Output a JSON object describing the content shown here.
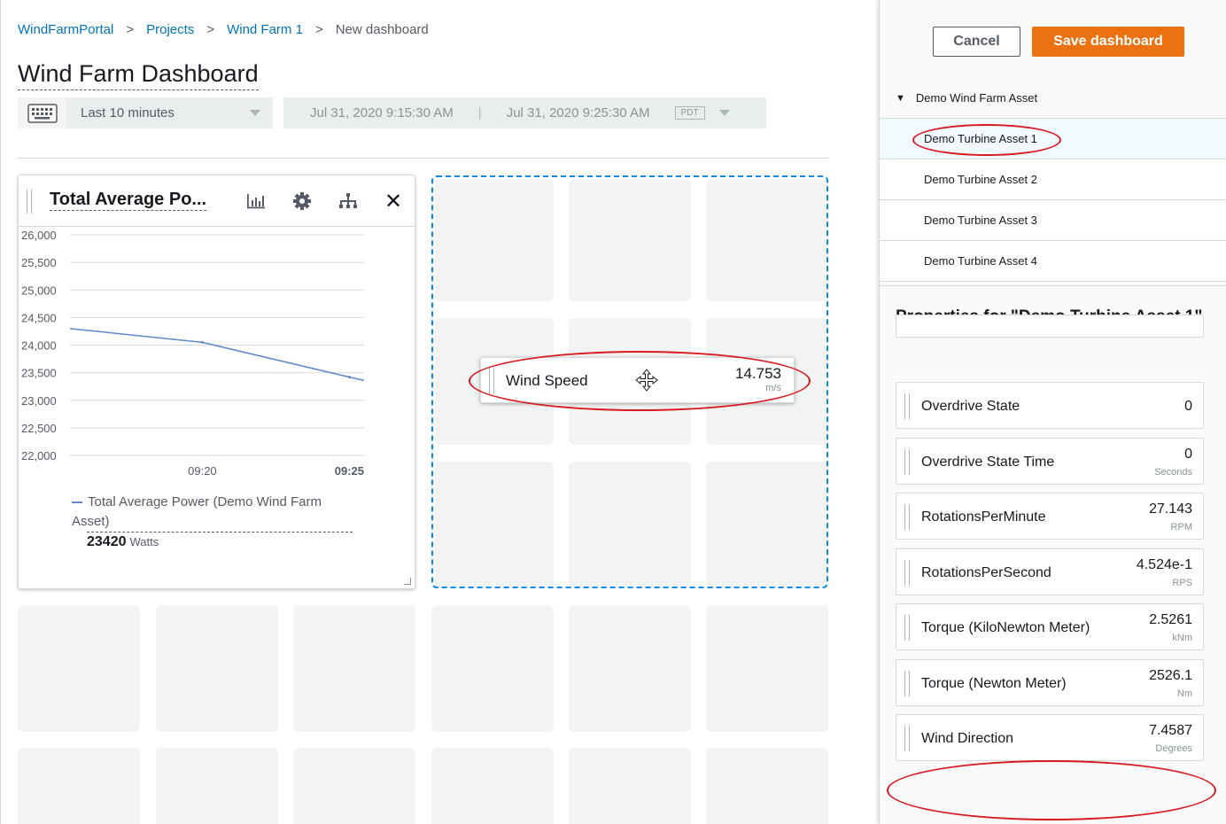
{
  "breadcrumb": {
    "items": [
      "WindFarmPortal",
      "Projects",
      "Wind Farm 1"
    ],
    "current": "New dashboard",
    "separator": ">"
  },
  "page_title": "Wind Farm Dashboard",
  "time_controls": {
    "range": "Last 10 minutes",
    "start": "Jul 31, 2020 9:15:30 AM",
    "end": "Jul 31, 2020 9:25:30 AM",
    "range_separator": "|",
    "timezone": "PDT"
  },
  "line_widget": {
    "title": "Total Average Po...",
    "icons": [
      "bar-chart-icon",
      "gear-icon",
      "hierarchy-icon",
      "close-icon"
    ],
    "close_glyph": "✕",
    "legend_name": "Total Average Power (Demo Wind Farm Asset)",
    "legend_value": "23420",
    "legend_unit": "Watts"
  },
  "chart_data": {
    "type": "line",
    "title": "Total Average Po...",
    "xlabel": "",
    "ylabel": "",
    "ylim": [
      22000,
      26000
    ],
    "y_ticks": [
      "26,000",
      "25,500",
      "25,000",
      "24,500",
      "24,000",
      "23,500",
      "23,000",
      "22,500",
      "22,000"
    ],
    "x_ticks": [
      "09:20",
      "09:25"
    ],
    "series": [
      {
        "name": "Total Average Power (Demo Wind Farm Asset)",
        "x": [
          "09:15:30",
          "09:20",
          "09:25",
          "09:25:30"
        ],
        "values": [
          24300,
          24050,
          23420,
          23360
        ]
      }
    ],
    "color": "#5f87c9",
    "grid": true
  },
  "dragged_widget": {
    "name": "Wind Speed",
    "value": "14.753",
    "unit": "m/s"
  },
  "side_panel": {
    "cancel_label": "Cancel",
    "save_label": "Save dashboard",
    "tree": {
      "root": "Demo Wind Farm Asset",
      "root_caret": "▼",
      "children": [
        "Demo Turbine Asset 1",
        "Demo Turbine Asset 2",
        "Demo Turbine Asset 3",
        "Demo Turbine Asset 4"
      ]
    },
    "properties_title": "Properties for \"Demo Turbine Asset 1\"",
    "properties": [
      {
        "name": "Overdrive State",
        "value": "0",
        "unit": ""
      },
      {
        "name": "Overdrive State Time",
        "value": "0",
        "unit": "Seconds"
      },
      {
        "name": "RotationsPerMinute",
        "value": "27.143",
        "unit": "RPM"
      },
      {
        "name": "RotationsPerSecond",
        "value": "4.524e-1",
        "unit": "RPS"
      },
      {
        "name": "Torque (KiloNewton Meter)",
        "value": "2.5261",
        "unit": "kNm"
      },
      {
        "name": "Torque (Newton Meter)",
        "value": "2526.1",
        "unit": "Nm"
      },
      {
        "name": "Wind Direction",
        "value": "7.4587",
        "unit": "Degrees"
      }
    ]
  },
  "colors": {
    "link": "#0073bb",
    "primary_button": "#ec7211",
    "drop_zone": "#0a8be5",
    "annotation": "#d71920",
    "series": "#5f87c9"
  }
}
